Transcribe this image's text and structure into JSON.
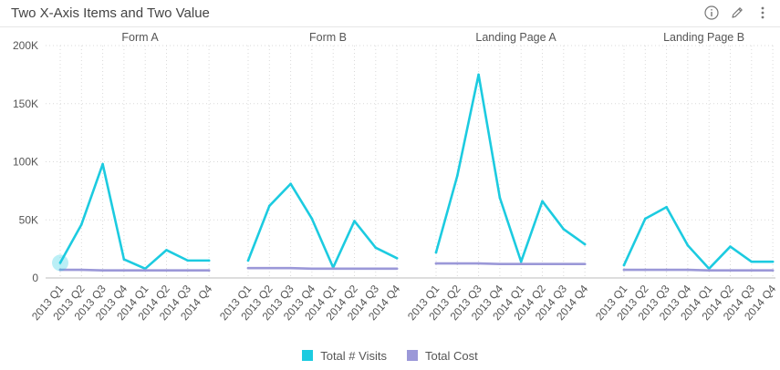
{
  "header": {
    "title": "Two X-Axis Items and Two Value",
    "icons": [
      "info-icon",
      "edit-pencil-icon",
      "more-vertical-icon"
    ]
  },
  "colors": {
    "visits": "#1ccbe0",
    "cost": "#9b98d8",
    "grid": "#d9d9d9",
    "text": "#555555"
  },
  "chart_data": {
    "type": "line",
    "title": "Two X-Axis Items and Two Value",
    "ylim": [
      0,
      200000
    ],
    "yticks": [
      0,
      50000,
      100000,
      150000,
      200000
    ],
    "ytick_labels": [
      "0",
      "50K",
      "100K",
      "150K",
      "200K"
    ],
    "categories": [
      "2013 Q1",
      "2013 Q2",
      "2013 Q3",
      "2013 Q4",
      "2014 Q1",
      "2014 Q2",
      "2014 Q3",
      "2014 Q4"
    ],
    "grid": true,
    "legend_position": "bottom",
    "panels": [
      {
        "name": "Form A",
        "series": [
          {
            "name": "Total # Visits",
            "values": [
              13000,
              46000,
              98000,
              16000,
              8000,
              24000,
              15000,
              15000
            ]
          },
          {
            "name": "Total Cost",
            "values": [
              7000,
              7000,
              6500,
              6500,
              6500,
              6500,
              6500,
              6500
            ]
          }
        ]
      },
      {
        "name": "Form B",
        "series": [
          {
            "name": "Total # Visits",
            "values": [
              15000,
              62000,
              81000,
              51000,
              9000,
              49000,
              26000,
              17000
            ]
          },
          {
            "name": "Total Cost",
            "values": [
              8500,
              8500,
              8500,
              8000,
              8000,
              8000,
              8000,
              8000
            ]
          }
        ]
      },
      {
        "name": "Landing Page A",
        "series": [
          {
            "name": "Total # Visits",
            "values": [
              22000,
              88000,
              175000,
              69000,
              14000,
              66000,
              42000,
              29000
            ]
          },
          {
            "name": "Total Cost",
            "values": [
              12500,
              12500,
              12500,
              12000,
              12000,
              12000,
              12000,
              12000
            ]
          }
        ]
      },
      {
        "name": "Landing Page B",
        "series": [
          {
            "name": "Total # Visits",
            "values": [
              11000,
              51000,
              61000,
              28000,
              8000,
              27000,
              14000,
              14000
            ]
          },
          {
            "name": "Total Cost",
            "values": [
              7000,
              7000,
              7000,
              7000,
              6500,
              6500,
              6500,
              6500
            ]
          }
        ]
      }
    ]
  },
  "legend": [
    {
      "label": "Total # Visits"
    },
    {
      "label": "Total Cost"
    }
  ]
}
